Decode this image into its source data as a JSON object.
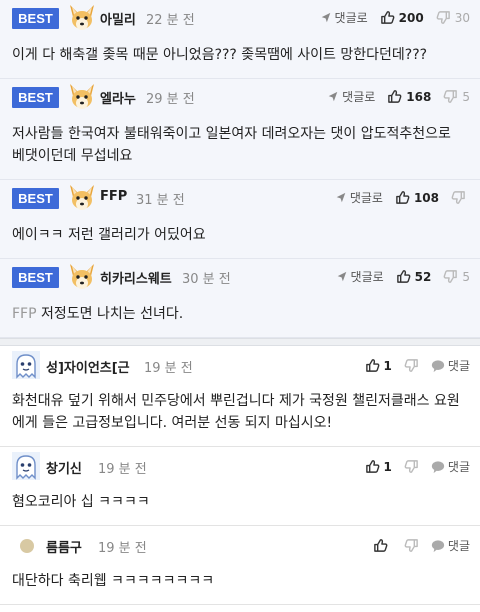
{
  "best_comments": [
    {
      "badge": "BEST",
      "user": "아밀리",
      "time": "22 분 전",
      "reply_label": "댓글로",
      "up": "200",
      "down": "30",
      "text": "이게 다 해축갤 좆목 때문 아니었음??? 좆목땜에 사이트 망한다던데???"
    },
    {
      "badge": "BEST",
      "user": "엘라누",
      "time": "29 분 전",
      "reply_label": "댓글로",
      "up": "168",
      "down": "5",
      "text": "저사람들 한국여자 불태워죽이고 일본여자 데려오자는 댓이 압도적추천으로 베댓이던데 무섭네요"
    },
    {
      "badge": "BEST",
      "user": "FFP",
      "time": "31 분 전",
      "reply_label": "댓글로",
      "up": "108",
      "down": "",
      "text": "에이ㅋㅋ 저런 갤러리가 어딨어요"
    },
    {
      "badge": "BEST",
      "user": "히카리스웨트",
      "time": "30 분 전",
      "reply_label": "댓글로",
      "up": "52",
      "down": "5",
      "mention": "FFP",
      "text": "저정도면 나치는 선녀다."
    }
  ],
  "comments": [
    {
      "user": "성]자이언츠[근",
      "time": "19 분 전",
      "up": "1",
      "reply_label": "댓글",
      "text": "화천대유 덮기 위해서 민주당에서 뿌린겁니다 제가 국정원 챌린저클래스 요원에게 들은 고급정보입니다. 여러분 선동 되지 마십시오!"
    },
    {
      "user": "창기신",
      "time": "19 분 전",
      "up": "1",
      "reply_label": "댓글",
      "text": "혐오코리아 십 ㅋㅋㅋㅋ"
    },
    {
      "user": "름름구",
      "time": "19 분 전",
      "up": "",
      "reply_label": "댓글",
      "text": "대단하다 축리웹 ㅋㅋㅋㅋㅋㅋㅋㅋ"
    }
  ],
  "colors": {
    "badge": "#3d6ad8",
    "best_bg": "#f4f6fb"
  }
}
